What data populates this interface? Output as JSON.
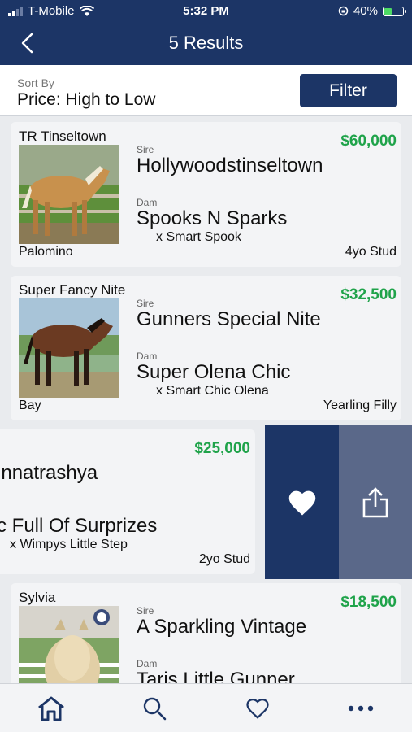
{
  "status": {
    "carrier": "T-Mobile",
    "time": "5:32 PM",
    "battery": "40%"
  },
  "header": {
    "title": "5 Results"
  },
  "sort": {
    "label": "Sort By",
    "value": "Price: High to Low",
    "filter_label": "Filter"
  },
  "listings": [
    {
      "name": "TR Tinseltown",
      "price": "$60,000",
      "sire_label": "Sire",
      "sire": "Hollywoodstinseltown",
      "dam_label": "Dam",
      "dam": "Spooks N Sparks",
      "dam_sire": "x Smart Spook",
      "color": "Palomino",
      "description": "4yo Stud"
    },
    {
      "name": "Super Fancy Nite",
      "price": "$32,500",
      "sire_label": "Sire",
      "sire": "Gunners Special Nite",
      "dam_label": "Dam",
      "dam": "Super Olena Chic",
      "dam_sire": "x Smart Chic Olena",
      "color": "Bay",
      "description": "Yearling Filly"
    },
    {
      "name": "",
      "price": "$25,000",
      "sire_label": "e",
      "sire": "unnatrashya",
      "dam_label": "m",
      "dam": "rc Full Of Surprizes",
      "dam_sire": "x Wimpys Little Step",
      "color": "",
      "description": "2yo Stud"
    },
    {
      "name": "Sylvia",
      "price": "$18,500",
      "sire_label": "Sire",
      "sire": "A Sparkling Vintage",
      "dam_label": "Dam",
      "dam": "Taris Little Gunner",
      "dam_sire": "",
      "color": "",
      "description": ""
    }
  ],
  "swipe_actions": {
    "favorite_icon": "heart-icon",
    "share_icon": "share-icon"
  },
  "tabs": [
    {
      "icon": "home-icon"
    },
    {
      "icon": "search-icon"
    },
    {
      "icon": "heart-outline-icon"
    },
    {
      "icon": "more-icon"
    }
  ],
  "colors": {
    "navy": "#1c3566",
    "price_green": "#1fa34a",
    "share_gray": "#5a6889"
  }
}
